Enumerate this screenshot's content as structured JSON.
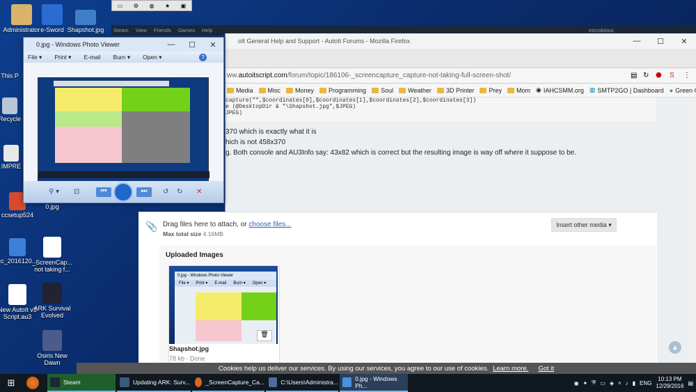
{
  "desktop": {
    "icons": [
      {
        "label": "Administrator",
        "name": "administrator-icon"
      },
      {
        "label": "e-Sword",
        "name": "esword-icon"
      },
      {
        "label": "Shapshot.jpg",
        "name": "snapshot-file-icon"
      },
      {
        "label": "This P",
        "name": "this-pc-icon"
      },
      {
        "label": "Recycle",
        "name": "recycle-bin-icon"
      },
      {
        "label": "IMPRE",
        "name": "impre-icon"
      },
      {
        "label": "ccsetup524",
        "name": "ccsetup-icon"
      },
      {
        "label": "0.jpg",
        "name": "zero-jpg-icon"
      },
      {
        "label": "cc_2016120...",
        "name": "cc-file-icon"
      },
      {
        "label": "_ScreenCap... not taking f...",
        "name": "screencap-file-icon"
      },
      {
        "label": "New AutoIt v3 Script.au3",
        "name": "autoit-script-icon"
      },
      {
        "label": "ARK Survival Evolved",
        "name": "ark-icon"
      },
      {
        "label": "Osiris New Dawn",
        "name": "osiris-icon"
      }
    ]
  },
  "steam": {
    "menu": [
      "Steam",
      "View",
      "Friends",
      "Games",
      "Help"
    ],
    "user": "microbious"
  },
  "firefox": {
    "title": "oIt General Help and Support - AutoIt Forums - Mozilla Firefox",
    "url_prefix": "ww.",
    "url_domain": "autoitscript.com",
    "url_path": "/forum/topic/186106-_screencapture_capture-not-taking-full-screen-shot/",
    "bookmarks": [
      "Media",
      "Misc",
      "Money",
      "Programming",
      "Soul",
      "Weather",
      "3D Printer",
      "Prey",
      "Mom",
      "IAHCSMM.org",
      "SMTP2GO | Dashboard",
      "Green Card | USCIS"
    ],
    "code_lines": [
      "capture(\"\",$coordinates[0],$coordinates[1],$coordinates[2],$coordinates[3])",
      "e (@DesktopDir & \"\\Shapshot.jpg\",$JPEG)",
      "JPEG)"
    ],
    "post_lines": [
      "370 which is exactly what it is",
      "hich is not 458x370",
      "g. Both console and AU3Info say: 43x82 which is correct but the resulting image is way off where it suppose to be."
    ],
    "attach": {
      "drag_text": "Drag files here to attach, or",
      "choose_link": "choose files...",
      "max_label": "Max total size",
      "max_value": "4.16MB",
      "insert_button": "Insert other media ▾",
      "uploaded_heading": "Uploaded Images",
      "file_name": "Shapshot.jpg",
      "file_meta": "78 kb · Done"
    },
    "cookie": {
      "text": "Cookies help us deliver our services. By using our services, you agree to our use of cookies.",
      "learn": "Learn more.",
      "ok": "Got it"
    }
  },
  "photo_viewer": {
    "title": "0.jpg - Windows Photo Viewer",
    "menu": [
      "File ▾",
      "Print ▾",
      "E-mail",
      "Burn ▾",
      "Open ▾"
    ],
    "thumb_menu": [
      "File ▾",
      "Print ▾",
      "E-mail",
      "Burn ▾",
      "Open ▾"
    ]
  },
  "taskbar": {
    "items": [
      "Steam",
      "Updating ARK: Surv...",
      "_ScreenCapture_Ca...",
      "C:\\Users\\Administra...",
      "0.jpg - Windows Ph..."
    ],
    "lang": "ENG",
    "time": "10:13 PM",
    "date": "12/29/2016"
  }
}
